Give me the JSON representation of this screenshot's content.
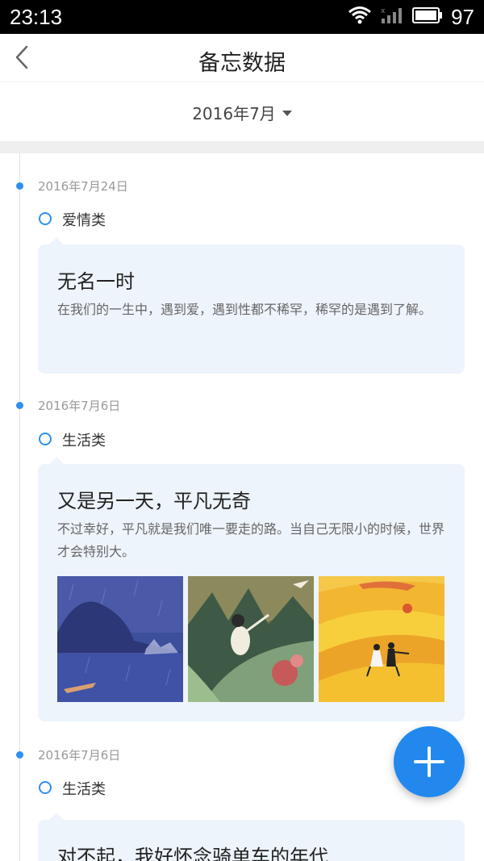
{
  "status_bar": {
    "time": "23:13",
    "battery": "97",
    "wifi_icon": "wifi-icon",
    "signal_icon": "signal-icon",
    "battery_icon": "battery-icon"
  },
  "header": {
    "title": "备忘数据",
    "back_icon": "chevron-left-icon"
  },
  "month_selector": {
    "label": "2016年7月",
    "icon": "caret-down-icon"
  },
  "entries": [
    {
      "date": "2016年7月24日",
      "category": "爱情类",
      "title": "无名一时",
      "body": "在我们的一生中，遇到爱，遇到性都不稀罕，稀罕的是遇到了解。"
    },
    {
      "date": "2016年7月6日",
      "category": "生活类",
      "title": "又是另一天，平凡无奇",
      "body": "不过幸好，平凡就是我们唯一要走的路。当自己无限小的时候，世界才会特别大。",
      "images": [
        "rainy-lake-boat-illustration",
        "girl-in-forest-illustration",
        "couple-in-golden-field-illustration"
      ]
    },
    {
      "date": "2016年7月6日",
      "category": "生活类",
      "title": "对不起，我好怀念骑单车的年代"
    }
  ],
  "fab": {
    "icon": "plus-icon"
  },
  "colors": {
    "accent": "#2e8ff0",
    "fab": "#2288ee",
    "card_bg": "#eef4fc",
    "status_bar": "#000000"
  }
}
